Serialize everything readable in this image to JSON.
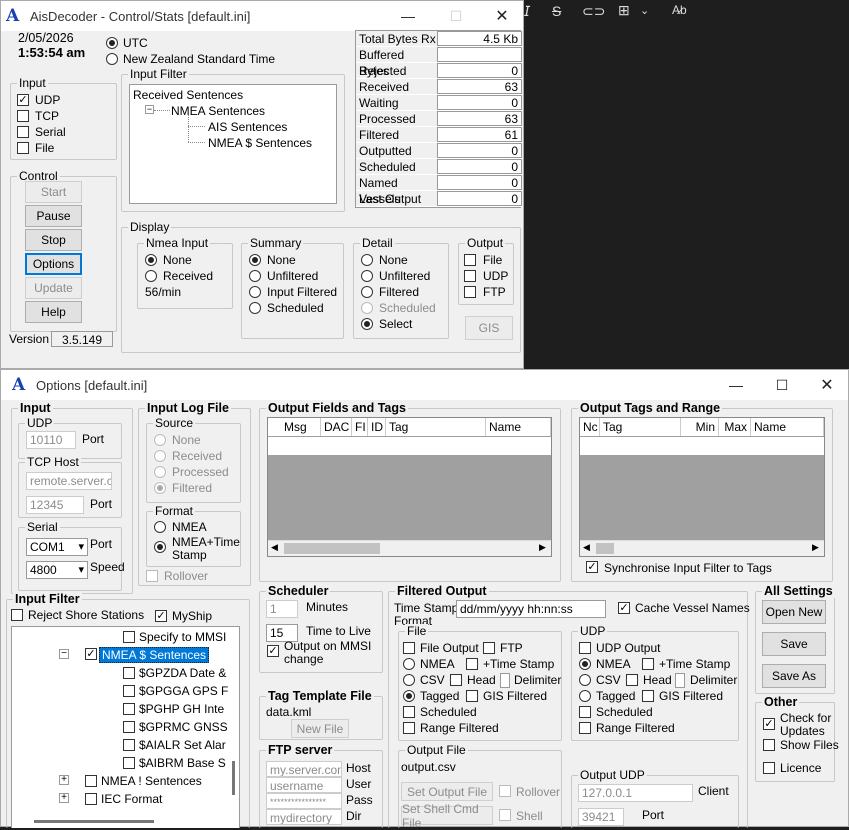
{
  "bg_toolbar": {
    "icons": [
      "italic-icon",
      "strikethrough-icon",
      "link-icon",
      "table-icon",
      "chevron-down-icon",
      "spellcheck-icon"
    ]
  },
  "decoder": {
    "logo": "A",
    "title": "AisDecoder - Control/Stats [default.ini]",
    "date": "2/05/2026",
    "time": "1:53:54 am",
    "tz_utc": "UTC",
    "tz_nz": "New Zealand Standard Time",
    "input": {
      "legend": "Input",
      "items": [
        {
          "label": "UDP",
          "checked": true
        },
        {
          "label": "TCP",
          "checked": false
        },
        {
          "label": "Serial",
          "checked": false
        },
        {
          "label": "File",
          "checked": false
        }
      ]
    },
    "input_filter": {
      "legend": "Input Filter",
      "tree": [
        "Received Sentences",
        "NMEA Sentences",
        "AIS Sentences",
        "NMEA $ Sentences"
      ],
      "expander": "−"
    },
    "stats": [
      [
        "Total Bytes Rx",
        "4.5 Kb"
      ],
      [
        "Buffered Bytes",
        ""
      ],
      [
        "Rejected",
        "0"
      ],
      [
        "Received",
        "63"
      ],
      [
        "Waiting",
        "0"
      ],
      [
        "Processed",
        "63"
      ],
      [
        "Filtered",
        "61"
      ],
      [
        "Outputted",
        "0"
      ],
      [
        "Scheduled",
        "0"
      ],
      [
        "Named Vessels",
        "0"
      ],
      [
        "Last Output",
        "0"
      ]
    ],
    "control": {
      "legend": "Control",
      "buttons": [
        "Start",
        "Pause",
        "Stop",
        "Options",
        "Update",
        "Help"
      ]
    },
    "version_label": "Version",
    "version": "3.5.149",
    "display": {
      "legend": "Display",
      "nmea": {
        "legend": "Nmea Input",
        "opts": [
          "None",
          "Received"
        ],
        "rate": "56/min"
      },
      "summary": {
        "legend": "Summary",
        "opts": [
          "None",
          "Unfiltered",
          "Input Filtered",
          "Scheduled"
        ]
      },
      "detail": {
        "legend": "Detail",
        "opts": [
          "None",
          "Unfiltered",
          "Filtered",
          "Scheduled",
          "Select"
        ]
      },
      "output": {
        "legend": "Output",
        "opts": [
          "File",
          "UDP",
          "FTP"
        ]
      },
      "gis": "GIS"
    }
  },
  "options": {
    "logo": "A",
    "title": "Options [default.ini]",
    "input": {
      "legend": "Input",
      "udp_legend": "UDP",
      "udp_port": "10110",
      "port_label": "Port",
      "tcp_legend": "TCP Host",
      "tcp_host": "remote.server.com",
      "tcp_port": "12345",
      "serial_legend": "Serial",
      "com": "COM1",
      "speed": "4800",
      "speed_label": "Speed"
    },
    "log": {
      "legend": "Input Log File",
      "source_legend": "Source",
      "source": [
        "None",
        "Received",
        "Processed",
        "Filtered"
      ],
      "format_legend": "Format",
      "format": [
        "NMEA",
        "NMEA+Time",
        "Stamp"
      ],
      "rollover": "Rollover"
    },
    "fields": {
      "legend": "Output Fields and Tags",
      "cols": [
        "Msg",
        "DAC",
        "FI",
        "ID",
        "Tag",
        "Name"
      ]
    },
    "tags": {
      "legend": "Output Tags and Range",
      "cols": [
        "Nc",
        "Tag",
        "Min",
        "Max",
        "Name"
      ],
      "sync": "Synchronise Input Filter to Tags"
    },
    "settings": {
      "legend": "All Settings",
      "buttons": [
        "Open New",
        "Save",
        "Save As"
      ]
    },
    "other": {
      "legend": "Other",
      "items": [
        "Check for",
        "Updates",
        "Show Files",
        "Licence"
      ]
    },
    "ifilter": {
      "legend": "Input Filter",
      "reject": "Reject Shore Stations",
      "myship": "MyShip",
      "tree": [
        "Specify to MMSI",
        "NMEA $ Sentences",
        "$GPZDA Date &",
        "$GPGGA GPS F",
        "$PGHP GH Inte",
        "$GPRMC GNSS",
        "$AIALR Set Alar",
        "$AIBRM Base S",
        "NMEA ! Sentences",
        "IEC Format"
      ],
      "minus": "−",
      "plus": "+"
    },
    "scheduler": {
      "legend": "Scheduler",
      "minutes_val": "1",
      "minutes": "Minutes",
      "ttl_val": "15",
      "ttl": "Time to Live",
      "mmsi1": "Output on MMSI",
      "mmsi2": "change"
    },
    "template": {
      "legend": "Tag Template File",
      "file": "data.kml",
      "btn": "New File"
    },
    "ftp": {
      "legend": "FTP server",
      "host": "my.server.com",
      "host_l": "Host",
      "user": "username",
      "user_l": "User",
      "pass": "****************",
      "pass_l": "Pass",
      "dir": "mydirectory",
      "dir_l": "Dir"
    },
    "fout": {
      "legend": "Filtered Output",
      "ts_label1": "Time Stamp",
      "ts_label2": "Format",
      "ts_value": "dd/mm/yyyy hh:nn:ss",
      "cache": "Cache Vessel Names",
      "file": {
        "legend": "File",
        "output": "File Output",
        "ftp": "FTP",
        "nmea": "NMEA",
        "time": "+Time Stamp",
        "csv": "CSV",
        "head": "Head",
        "delim": "Delimiter",
        "tagged": "Tagged",
        "gis": "GIS Filtered",
        "sched": "Scheduled",
        "range": "Range Filtered"
      },
      "udp": {
        "legend": "UDP",
        "output": "UDP Output",
        "nmea": "NMEA",
        "time": "+Time Stamp",
        "csv": "CSV",
        "head": "Head",
        "delim": "Delimiter",
        "tagged": "Tagged",
        "gis": "GIS Filtered",
        "sched": "Scheduled",
        "range": "Range Filtered"
      },
      "ofile": {
        "legend": "Output File",
        "name": "output.csv",
        "btn1": "Set Output File",
        "roll": "Rollover",
        "btn2": "Set Shell Cmd File",
        "shell": "Shell"
      },
      "oudp": {
        "legend": "Output UDP",
        "ip": "127.0.0.1",
        "client": "Client",
        "port": "39421",
        "port_l": "Port"
      }
    }
  }
}
